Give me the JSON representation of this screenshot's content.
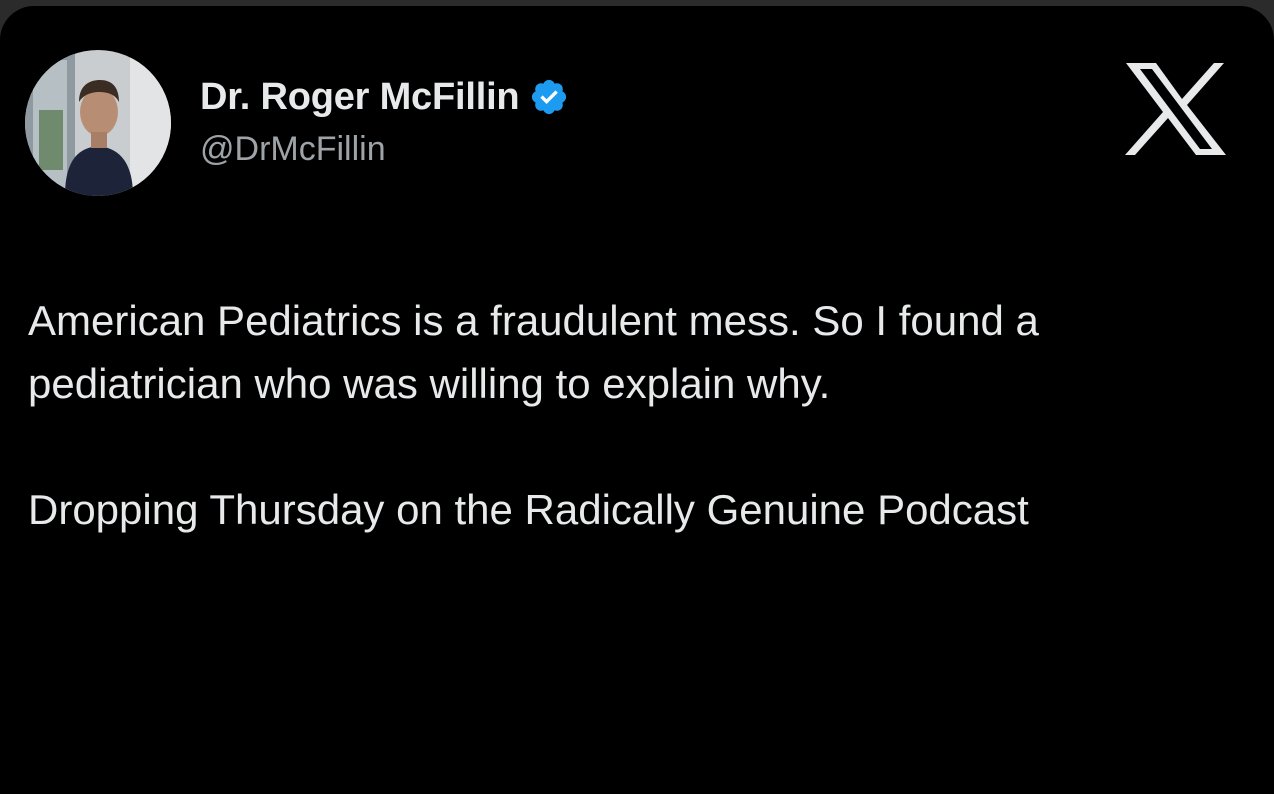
{
  "post": {
    "author": {
      "display_name": "Dr. Roger McFillin",
      "handle": "@DrMcFillin",
      "verified": true,
      "verified_icon": "verified-badge-icon",
      "avatar_icon": "profile-photo"
    },
    "brand_icon": "x-logo-icon",
    "body": {
      "paragraph_1": "American Pediatrics is a fraudulent mess. So I found a pediatrician who was willing to explain why.",
      "paragraph_2": "Dropping Thursday on the Radically Genuine Podcast"
    }
  },
  "colors": {
    "background": "#000000",
    "text_primary": "#e7e9ea",
    "text_secondary": "#9ea3a8",
    "verified_blue": "#1d9bf0",
    "outer_frame": "#2b2b2b"
  }
}
